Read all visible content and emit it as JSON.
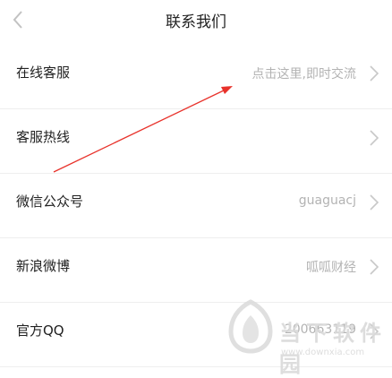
{
  "header": {
    "title": "联系我们",
    "back_icon": "chevron-left-icon"
  },
  "rows": [
    {
      "label": "在线客服",
      "value": "点击这里,即时交流"
    },
    {
      "label": "客服热线",
      "value": ""
    },
    {
      "label": "微信公众号",
      "value": "guaguacj"
    },
    {
      "label": "新浪微博",
      "value": "呱呱财经"
    },
    {
      "label": "官方QQ",
      "value": "200663119"
    }
  ],
  "annotation": {
    "color": "#e8322b"
  },
  "watermark": {
    "brand": "当下软件园",
    "url": "www.downxia.com"
  },
  "colors": {
    "background": "#ffffff",
    "text": "#222222",
    "secondary_text": "#b3b3b3",
    "divider": "#eeeeee"
  }
}
